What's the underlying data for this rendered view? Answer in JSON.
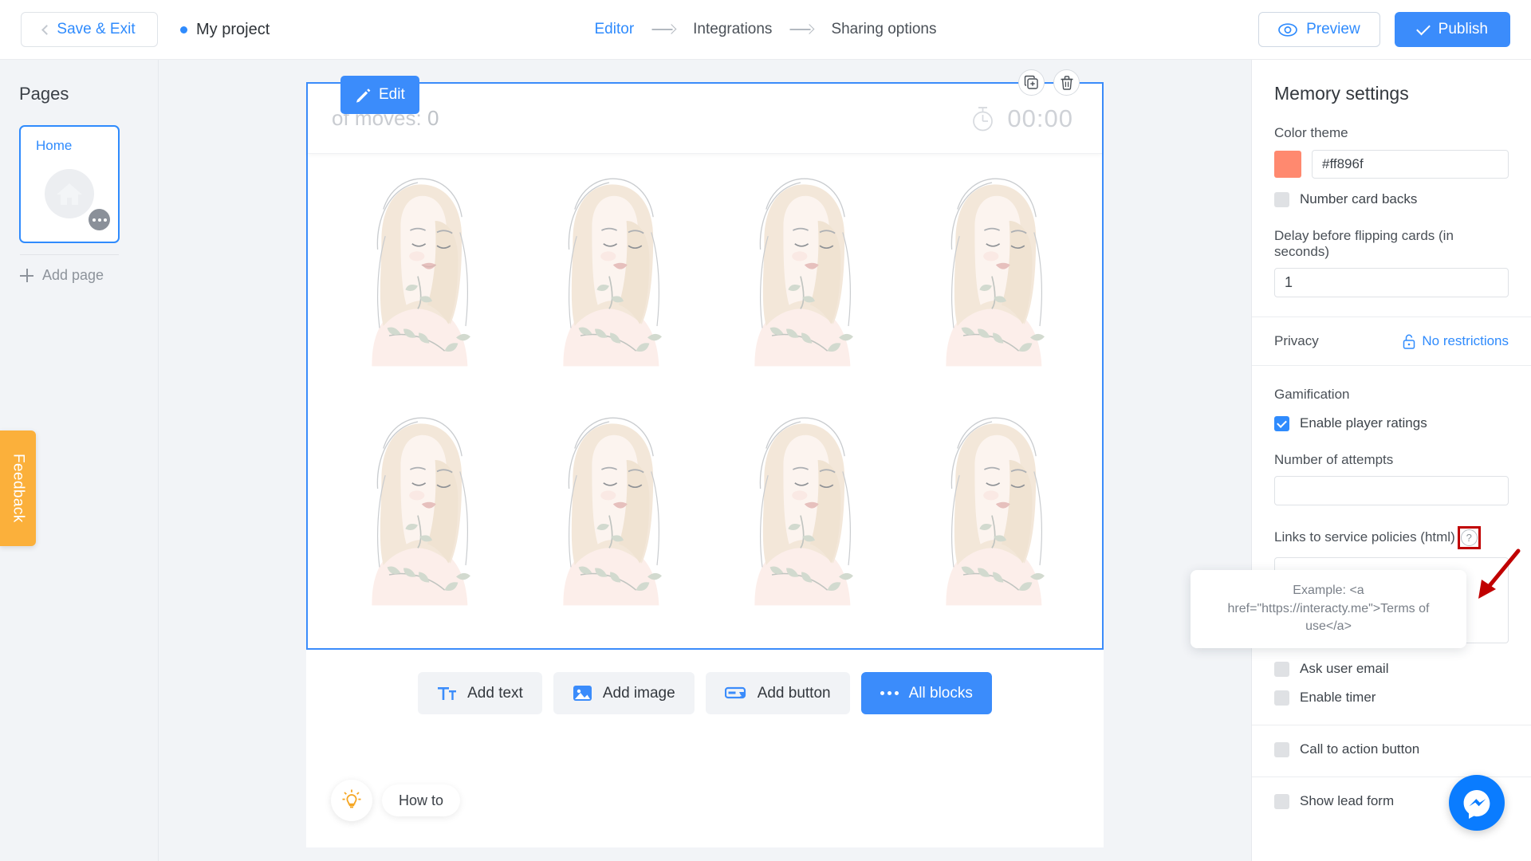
{
  "topbar": {
    "save_exit": "Save & Exit",
    "project_name": "My project",
    "breadcrumbs": [
      {
        "label": "Editor",
        "active": true
      },
      {
        "label": "Integrations",
        "active": false
      },
      {
        "label": "Sharing options",
        "active": false
      }
    ],
    "preview": "Preview",
    "publish": "Publish"
  },
  "sidebar": {
    "title": "Pages",
    "page": {
      "label": "Home",
      "icon": "home-icon"
    },
    "add_page": "Add page",
    "feedback": "Feedback",
    "how_to": "How to"
  },
  "canvas": {
    "moves_label": "of moves:",
    "moves_value": "0",
    "timer_value": "00:00",
    "edit_label": "Edit",
    "card_count": 8,
    "card_image": "woman-botanical-illustration",
    "tools": [
      "duplicate-icon",
      "delete-icon"
    ],
    "add_blocks": [
      {
        "label": "Add text",
        "icon": "text-icon",
        "primary": false
      },
      {
        "label": "Add image",
        "icon": "image-icon",
        "primary": false
      },
      {
        "label": "Add button",
        "icon": "button-icon",
        "primary": false
      },
      {
        "label": "All blocks",
        "icon": "ellipsis-icon",
        "primary": true
      }
    ]
  },
  "settings": {
    "title": "Memory settings",
    "color_theme_label": "Color theme",
    "color_theme_value": "#ff896f",
    "color_swatch": "#ff896f",
    "number_card_backs": {
      "label": "Number card backs",
      "checked": false
    },
    "delay_label": "Delay before flipping cards (in seconds)",
    "delay_value": "1",
    "privacy_label": "Privacy",
    "privacy_value": "No restrictions",
    "gamification_label": "Gamification",
    "enable_player_ratings": {
      "label": "Enable player ratings",
      "checked": true
    },
    "attempts_label": "Number of attempts",
    "attempts_value": "",
    "links_label": "Links to service policies (html)",
    "links_value": "",
    "tooltip": "Example: <a href=\"https://interacty.me\">Terms of use</a>",
    "ask_user_email": {
      "label": "Ask user email",
      "checked": false
    },
    "enable_timer": {
      "label": "Enable timer",
      "checked": false
    },
    "call_to_action": {
      "label": "Call to action button",
      "checked": false
    },
    "show_lead_form": {
      "label": "Show lead form",
      "checked": false
    }
  },
  "chat": {
    "icon": "messenger-icon"
  }
}
